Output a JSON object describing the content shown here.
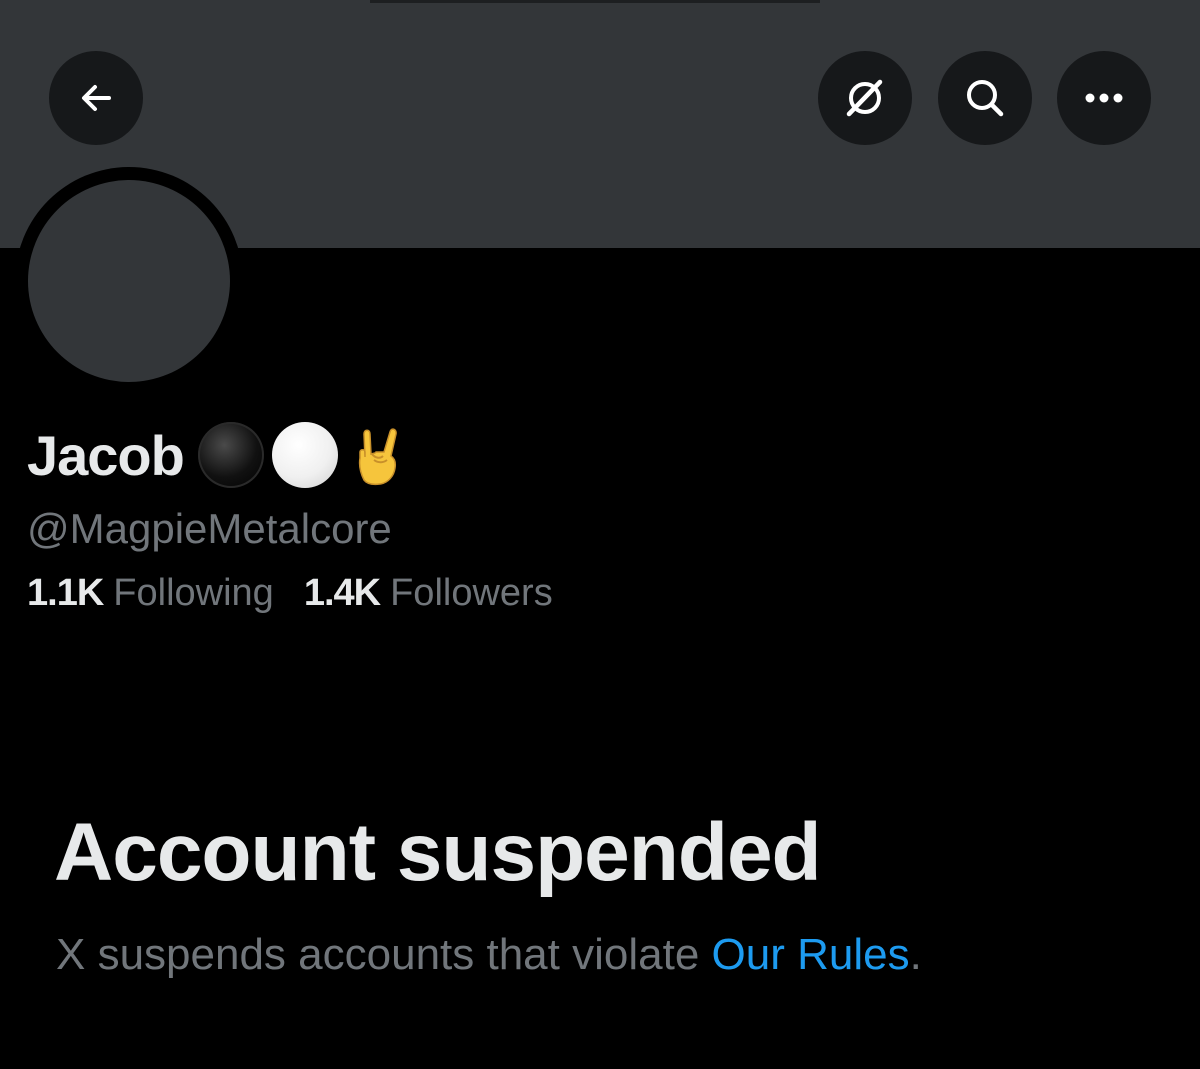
{
  "header": {
    "back_icon": "arrow-left-icon",
    "grok_icon": "grok-icon",
    "search_icon": "search-icon",
    "more_icon": "more-horizontal-icon",
    "banner_color": "#333639"
  },
  "profile": {
    "display_name": "Jacob",
    "emojis": [
      "black-circle",
      "white-circle",
      "sign-of-the-horns"
    ],
    "handle": "@MagpieMetalcore",
    "following_count": "1.1K",
    "following_label": "Following",
    "followers_count": "1.4K",
    "followers_label": "Followers"
  },
  "suspension": {
    "title": "Account suspended",
    "message_prefix": "X suspends accounts that violate ",
    "rules_link": "Our Rules",
    "message_suffix": "."
  },
  "colors": {
    "background": "#000000",
    "primary_text": "#e7e9ea",
    "secondary_text": "#71767b",
    "link": "#1d9bf0"
  }
}
